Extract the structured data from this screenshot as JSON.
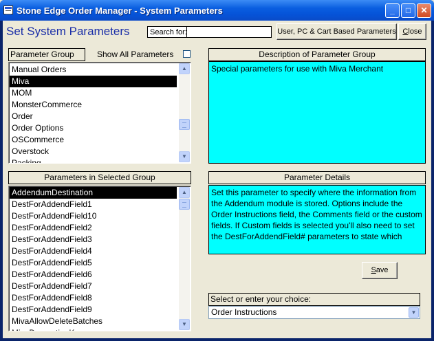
{
  "window": {
    "title": "Stone Edge Order Manager - System Parameters",
    "minimize_glyph": "_",
    "maximize_glyph": "□",
    "close_glyph": "✕"
  },
  "header": {
    "title": "Set System Parameters",
    "search_label": "Search for:",
    "search_value": "",
    "user_pc_cart_button": "User, PC & Cart Based Parameters",
    "close_button": "Close"
  },
  "parameter_group": {
    "label": "Parameter Group",
    "show_all_label": "Show All Parameters",
    "show_all_checked": false,
    "items": [
      "Manual Orders",
      "Miva",
      "MOM",
      "MonsterCommerce",
      "Order",
      "Order Options",
      "OSCommerce",
      "Overstock",
      "Packing"
    ],
    "selected_index": 1
  },
  "description": {
    "label": "Description of Parameter Group",
    "text": "Special parameters for use with Miva Merchant"
  },
  "parameters": {
    "label": "Parameters in Selected Group",
    "items": [
      "AddendumDestination",
      "DestForAddendField1",
      "DestForAddendField10",
      "DestForAddendField2",
      "DestForAddendField3",
      "DestForAddendField4",
      "DestForAddendField5",
      "DestForAddendField6",
      "DestForAddendField7",
      "DestForAddendField8",
      "DestForAddendField9",
      "MivaAllowDeleteBatches",
      "MivaDecorationKey"
    ],
    "selected_index": 0
  },
  "details": {
    "label": "Parameter Details",
    "text": "Set this parameter to specify where the information from the Addendum module is stored. Options include the Order Instructions field, the Comments field or the custom fields. If Custom fields is selected you'll also need to set the DestForAddendField# parameters to state which"
  },
  "save_button": "Save",
  "choice": {
    "label": "Select or enter your choice:",
    "value": "Order Instructions"
  },
  "icons": {
    "scroll_up": "▲",
    "scroll_down": "▼",
    "dropdown": "▼"
  }
}
